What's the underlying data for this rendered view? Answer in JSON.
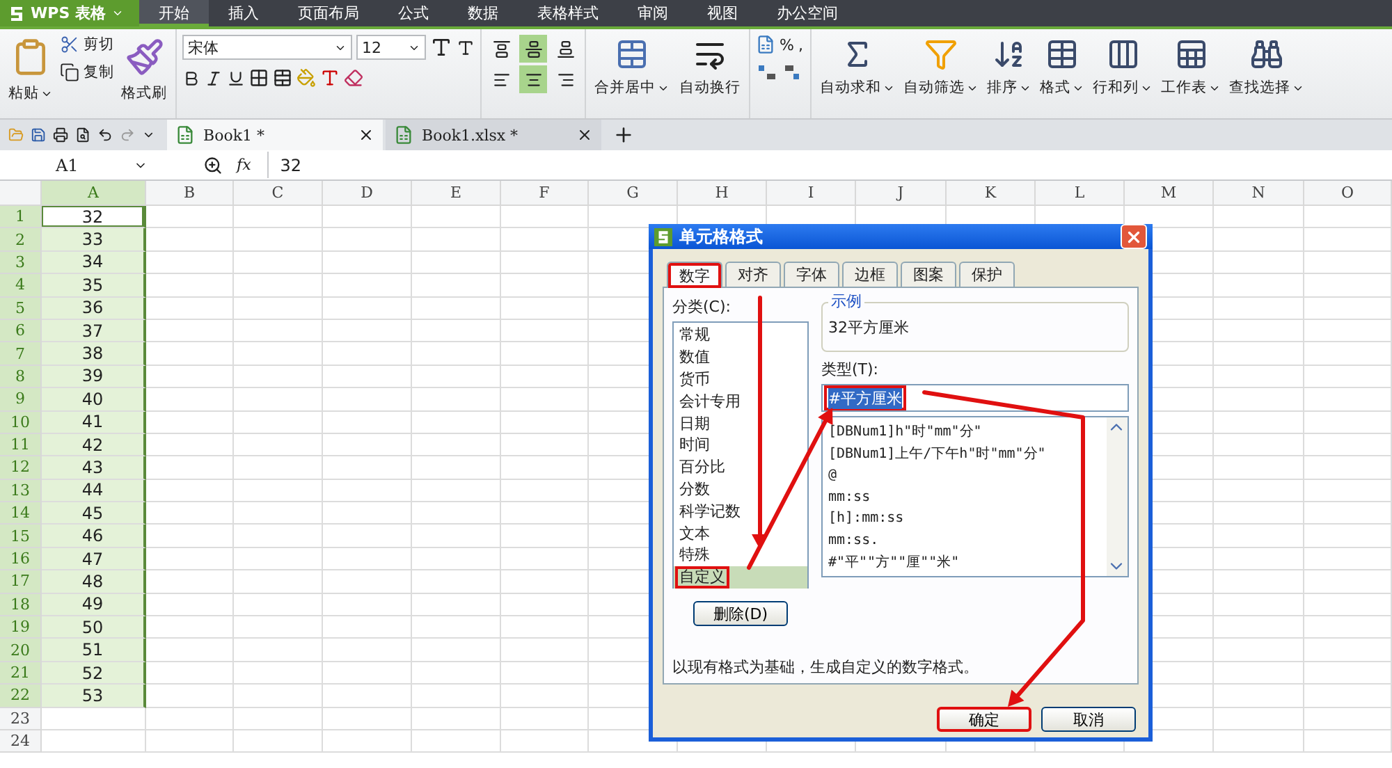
{
  "app": {
    "title": "WPS 表格"
  },
  "menu_tabs": [
    {
      "label": "开始",
      "selected": true
    },
    {
      "label": "插入",
      "selected": false
    },
    {
      "label": "页面布局",
      "selected": false
    },
    {
      "label": "公式",
      "selected": false
    },
    {
      "label": "数据",
      "selected": false
    },
    {
      "label": "表格样式",
      "selected": false
    },
    {
      "label": "审阅",
      "selected": false
    },
    {
      "label": "视图",
      "selected": false
    },
    {
      "label": "办公空间",
      "selected": false
    }
  ],
  "ribbon": {
    "paste": "粘贴",
    "cut": "剪切",
    "copy": "复制",
    "format_painter": "格式刷",
    "font_name": "宋体",
    "font_size": "12",
    "align_vertical": [
      {
        "selected": false
      },
      {
        "selected": true
      },
      {
        "selected": false
      }
    ],
    "align_horizontal": [
      {
        "selected": false
      },
      {
        "selected": true
      },
      {
        "selected": false
      }
    ],
    "merge": "合并居中",
    "wrap": "自动换行",
    "percent": "%",
    "comma": ",",
    "tools": [
      {
        "kind": "sum",
        "label": "自动求和"
      },
      {
        "kind": "filter",
        "label": "自动筛选"
      },
      {
        "kind": "sort",
        "label": "排序"
      },
      {
        "kind": "format",
        "label": "格式"
      },
      {
        "kind": "rowcol",
        "label": "行和列"
      },
      {
        "kind": "sheet",
        "label": "工作表"
      },
      {
        "kind": "find",
        "label": "查找选择"
      }
    ]
  },
  "doc_tabs": [
    {
      "label": "Book1 *",
      "selected": true
    },
    {
      "label": "Book1.xlsx *",
      "selected": false
    }
  ],
  "formula_bar": {
    "name_box": "A1",
    "fx": "fx",
    "value": "32"
  },
  "sheet": {
    "columns": [
      {
        "label": "A",
        "selected": true
      },
      {
        "label": "B",
        "selected": false
      },
      {
        "label": "C",
        "selected": false
      },
      {
        "label": "D",
        "selected": false
      },
      {
        "label": "E",
        "selected": false
      },
      {
        "label": "F",
        "selected": false
      },
      {
        "label": "G",
        "selected": false
      },
      {
        "label": "H",
        "selected": false
      },
      {
        "label": "I",
        "selected": false
      },
      {
        "label": "J",
        "selected": false
      },
      {
        "label": "K",
        "selected": false
      },
      {
        "label": "L",
        "selected": false
      },
      {
        "label": "M",
        "selected": false
      },
      {
        "label": "N",
        "selected": false
      },
      {
        "label": "O",
        "selected": false
      }
    ],
    "rows": [
      {
        "label": "1",
        "value": "32",
        "selected": true,
        "active": true
      },
      {
        "label": "2",
        "value": "33",
        "selected": true,
        "active": false
      },
      {
        "label": "3",
        "value": "34",
        "selected": true,
        "active": false
      },
      {
        "label": "4",
        "value": "35",
        "selected": true,
        "active": false
      },
      {
        "label": "5",
        "value": "36",
        "selected": true,
        "active": false
      },
      {
        "label": "6",
        "value": "37",
        "selected": true,
        "active": false
      },
      {
        "label": "7",
        "value": "38",
        "selected": true,
        "active": false
      },
      {
        "label": "8",
        "value": "39",
        "selected": true,
        "active": false
      },
      {
        "label": "9",
        "value": "40",
        "selected": true,
        "active": false
      },
      {
        "label": "10",
        "value": "41",
        "selected": true,
        "active": false
      },
      {
        "label": "11",
        "value": "42",
        "selected": true,
        "active": false
      },
      {
        "label": "12",
        "value": "43",
        "selected": true,
        "active": false
      },
      {
        "label": "13",
        "value": "44",
        "selected": true,
        "active": false
      },
      {
        "label": "14",
        "value": "45",
        "selected": true,
        "active": false
      },
      {
        "label": "15",
        "value": "46",
        "selected": true,
        "active": false
      },
      {
        "label": "16",
        "value": "47",
        "selected": true,
        "active": false
      },
      {
        "label": "17",
        "value": "48",
        "selected": true,
        "active": false
      },
      {
        "label": "18",
        "value": "49",
        "selected": true,
        "active": false
      },
      {
        "label": "19",
        "value": "50",
        "selected": true,
        "active": false
      },
      {
        "label": "20",
        "value": "51",
        "selected": true,
        "active": false
      },
      {
        "label": "21",
        "value": "52",
        "selected": true,
        "active": false
      },
      {
        "label": "22",
        "value": "53",
        "selected": true,
        "active": false
      },
      {
        "label": "23",
        "selected": false,
        "active": false
      },
      {
        "label": "24",
        "selected": false,
        "active": false
      }
    ]
  },
  "dialog": {
    "title": "单元格格式",
    "tabs": [
      {
        "label": "数字",
        "selected": true,
        "highlighted": true
      },
      {
        "label": "对齐",
        "selected": false,
        "highlighted": false
      },
      {
        "label": "字体",
        "selected": false,
        "highlighted": false
      },
      {
        "label": "边框",
        "selected": false,
        "highlighted": false
      },
      {
        "label": "图案",
        "selected": false,
        "highlighted": false
      },
      {
        "label": "保护",
        "selected": false,
        "highlighted": false
      }
    ],
    "category_label": "分类(C):",
    "categories": [
      {
        "label": "常规",
        "selected": false
      },
      {
        "label": "数值",
        "selected": false
      },
      {
        "label": "货币",
        "selected": false
      },
      {
        "label": "会计专用",
        "selected": false
      },
      {
        "label": "日期",
        "selected": false
      },
      {
        "label": "时间",
        "selected": false
      },
      {
        "label": "百分比",
        "selected": false
      },
      {
        "label": "分数",
        "selected": false
      },
      {
        "label": "科学记数",
        "selected": false
      },
      {
        "label": "文本",
        "selected": false
      },
      {
        "label": "特殊",
        "selected": false
      },
      {
        "label": "自定义",
        "selected": true,
        "highlighted": true
      }
    ],
    "sample_label": "示例",
    "sample": "32平方厘米",
    "type_label": "类型(T):",
    "type_value": "#平方厘米",
    "type_highlighted": true,
    "formats": [
      "[DBNum1]h\"时\"mm\"分\"",
      "[DBNum1]上午/下午h\"时\"mm\"分\"",
      "@",
      "mm:ss",
      "[h]:mm:ss",
      "mm:ss.",
      "#\"平\"\"方\"\"厘\"\"米\""
    ],
    "delete_button": "删除(D)",
    "description": "以现有格式为基础，生成自定义的数字格式。",
    "ok_button": "确定",
    "ok_highlighted": true,
    "cancel_button": "取消"
  }
}
